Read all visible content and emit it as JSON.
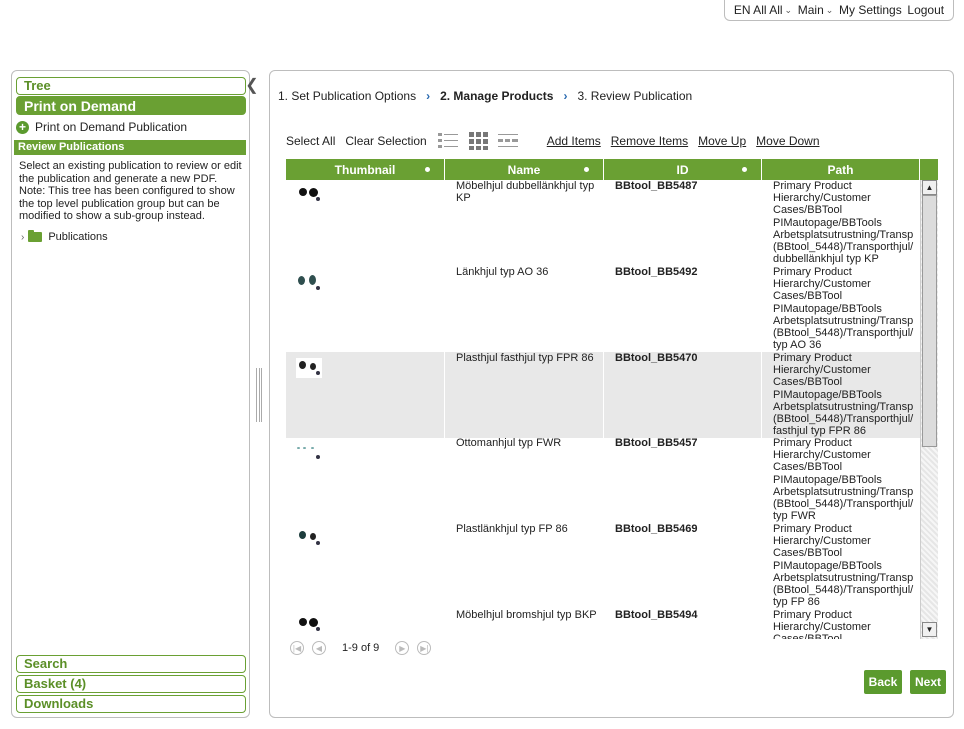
{
  "topbar": {
    "language": "EN All All",
    "main": "Main",
    "settings": "My Settings",
    "logout": "Logout"
  },
  "sidebar": {
    "tree": "Tree",
    "print_on_demand": "Print on Demand",
    "pod_publication": "Print on Demand Publication",
    "review_header": "Review Publications",
    "review_desc": "Select an existing publication to review or edit the publication and generate a new PDF. Note: This tree has been configured to show the top level publication group but can be modified to show a sub-group instead.",
    "publications_node": "Publications",
    "search": "Search",
    "basket": "Basket (4)",
    "downloads": "Downloads"
  },
  "steps": {
    "step1": "1. Set Publication Options",
    "step2": "2. Manage Products",
    "step3": "3. Review Publication"
  },
  "toolbar": {
    "select_all": "Select All",
    "clear_selection": "Clear Selection",
    "add_items": "Add Items",
    "remove_items": "Remove Items",
    "move_up": "Move Up",
    "move_down": "Move Down"
  },
  "table": {
    "headers": {
      "thumbnail": "Thumbnail",
      "name": "Name",
      "id": "ID",
      "path": "Path"
    },
    "rows": [
      {
        "name": "Möbelhjul dubbellänkhjul typ KP",
        "id": "BBtool_BB5487",
        "path": "Primary Product Hierarchy/Customer Cases/BBTool PIMautopage/BBTools Arbetsplatsutrustning/Transp (BBtool_5448)/Transporthjul/ dubbellänkhjul typ KP"
      },
      {
        "name": "Länkhjul typ AO 36",
        "id": "BBtool_BB5492",
        "path": "Primary Product Hierarchy/Customer Cases/BBTool PIMautopage/BBTools Arbetsplatsutrustning/Transp (BBtool_5448)/Transporthjul/ typ AO 36"
      },
      {
        "name": "Plasthjul fasthjul typ FPR 86",
        "id": "BBtool_BB5470",
        "path": "Primary Product Hierarchy/Customer Cases/BBTool PIMautopage/BBTools Arbetsplatsutrustning/Transp (BBtool_5448)/Transporthjul/ fasthjul typ FPR 86"
      },
      {
        "name": "Ottomanhjul typ FWR",
        "id": "BBtool_BB5457",
        "path": "Primary Product Hierarchy/Customer Cases/BBTool PIMautopage/BBTools Arbetsplatsutrustning/Transp (BBtool_5448)/Transporthjul/ typ FWR"
      },
      {
        "name": "Plastlänkhjul typ FP 86",
        "id": "BBtool_BB5469",
        "path": "Primary Product Hierarchy/Customer Cases/BBTool PIMautopage/BBTools Arbetsplatsutrustning/Transp (BBtool_5448)/Transporthjul/ typ FP 86"
      },
      {
        "name": "Möbelhjul bromshjul typ BKP",
        "id": "BBtool_BB5494",
        "path": "Primary Product Hierarchy/Customer Cases/BBTool"
      }
    ]
  },
  "pager": {
    "range": "1-9 of 9"
  },
  "buttons": {
    "back": "Back",
    "next": "Next"
  },
  "colors": {
    "accent_green": "#6aa033",
    "button_green": "#5b9a2e",
    "step_arrow": "#2a6ab0"
  }
}
